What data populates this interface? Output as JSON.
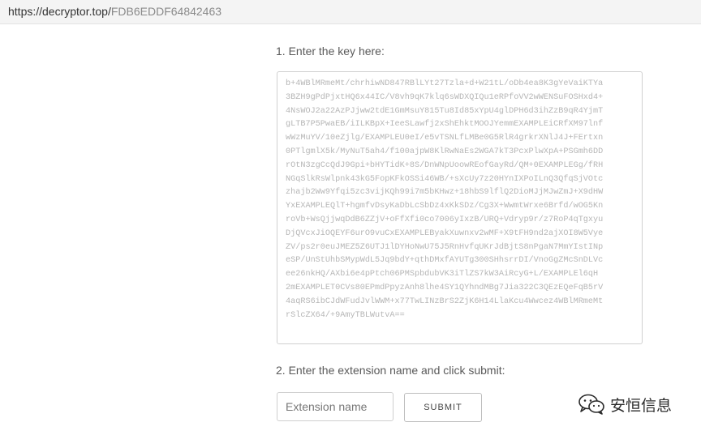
{
  "browser": {
    "url_host": "https://decryptor.top/",
    "url_path": "FDB6EDDF64842463"
  },
  "form": {
    "step1_label": "1. Enter the key here:",
    "key_text": "b+4WBlMRmeMt/chrhiwND847RBlLYt27Tzla+d+W21tL/oDb4ea8K3gYeVaiKTYa\n3BZH9gPdPjxtHQ6x44IC/V8vh9qK7klq6sWDXQIQu1eRPfoVV2wWENSuFOSHxd4+\n4NsWOJ2a22AzPJjww2tdE1GmMsuY815Tu8Id85xYpU4glDPH6d3ihZzB9qR4YjmT\ngLTB7P5PwaEB/iILKBpX+IeeSLawfj2xShEhktMOOJYemmEXAMPLEiCRfXM97lnf\nwWzMuYV/10eZjlg/EXAMPLEU0eI/e5vTSNLfLMBe0G5RlR4grkrXNlJ4J+FErtxn\n0PTlgmlX5k/MyNuT5ah4/f100ajpW8KlRwNaEs2WGA7kT3PcxPlwXpA+PSGmh6DD\nrOtN3zgCcQdJ9Gpi+bHYTidK+8S/DnWNpUoowREofGayRd/QM+0EXAMPLEGg/fRH\nNGqSlkRsWlpnk43kG5FopKFkOSSi46WB/+sXcUy7z20HYnIXPoILnQ3QfqSjVOtc\nzhajb2Ww9Yfqi5zc3vijKQh99i7m5bKHwz+18hbS9lflQ2DioMJjMJwZmJ+X9dHW\nYxEXAMPLEQlT+hgmfvDsyKaDbLcSbDz4xKkSDz/Cg3X+WwmtWrxe6Brfd/wOG5Kn\nroVb+WsQjjwqDdB6ZZjV+oFfXfi0co7006yIxzB/URQ+Vdryp9r/z7RoP4qTgxyu\nDjQVcxJiOQEYF6urO9vuCxEXAMPLEByakXuwnxv2wMF+X9tFH9nd2ajXOI8W5Vye\nZV/ps2r0euJMEZ5Z6UTJ1lDYHoNwU75J5RnHvfqUKrJdBjtS8nPgaN7MmYIstINp\neSP/UnStUhbSMypWdL5Jq9bdY+qthDMxfAYUTg300SHhsrrDI/VnoGgZMcSnDLVc\nee26nkHQ/AXbi6e4pPtch06PMSpbdubVK3iTlZS7kW3AiRcyG+L/EXAMPLEl6qH\n2mEXAMPLET0CVs80EPmdPpyzAnh8lhe4SY1QYhndMBg7Jia322C3QEzEQeFqB5rV\n4aqRS6ibCJdWFudJvlWWM+x77TwLINzBrS2ZjK6H14LlaKcu4Wwcez4WBlMRmeMt\nrSlcZX64/+9AmyTBLWutvA==",
    "step2_label": "2. Enter the extension name and click submit:",
    "extension_placeholder": "Extension name",
    "extension_value": "",
    "submit_label": "SUBMIT"
  },
  "watermark": {
    "icon": "wechat-icon",
    "text": "安恒信息"
  }
}
